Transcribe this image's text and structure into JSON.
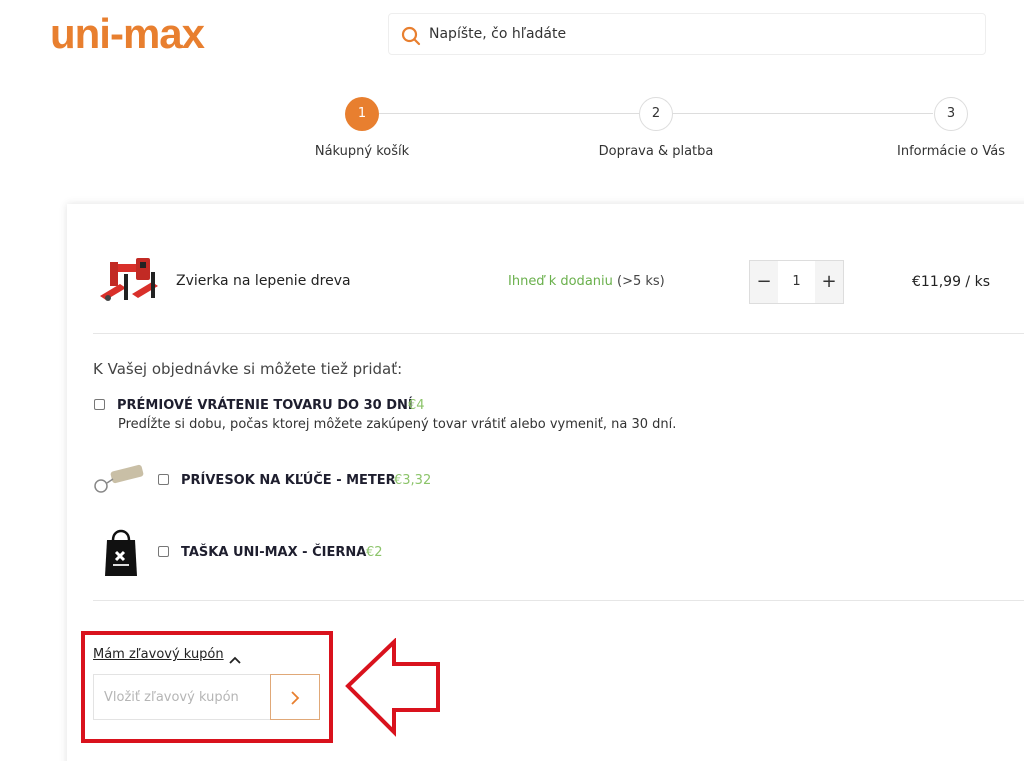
{
  "colors": {
    "brand": "#e87f2f",
    "available": "#6ab04c",
    "addon_price": "#8cc46a",
    "highlight": "#d9121d"
  },
  "header": {
    "logo_text": "uni-max",
    "search": {
      "placeholder": "Napíšte, čo hľadáte",
      "icon": "search-icon"
    }
  },
  "steps": [
    {
      "number": "1",
      "label": "Nákupný košík",
      "active": true
    },
    {
      "number": "2",
      "label": "Doprava & platba",
      "active": false
    },
    {
      "number": "3",
      "label": "Informácie o Vás",
      "active": false
    }
  ],
  "cart": {
    "item": {
      "name": "Zvierka na lepenie dreva",
      "availability": "Ihneď k dodaniu",
      "availability_qty": "(>5 ks)",
      "quantity": "1",
      "minus": "−",
      "plus": "+",
      "price": "€11,99 / ks",
      "image": "wood-clamp-image"
    }
  },
  "addons": {
    "title": "K Vašej objednávke si môžete tiež pridať:",
    "items": [
      {
        "name": "PRÉMIOVÉ VRÁTENIE TOVARU DO 30 DNÍ",
        "price": "€4",
        "description": "Predĺžte si dobu, počas ktorej môžete zakúpený tovar vrátiť alebo vymeniť, na 30 dní."
      },
      {
        "name": "PRÍVESOK NA KĽÚČE - METER",
        "price": "€3,32",
        "image": "keychain-meter-image"
      },
      {
        "name": "TAŠKA UNI-MAX - ČIERNA",
        "price": "€2",
        "image": "black-bag-image"
      }
    ]
  },
  "coupon": {
    "link_label": "Mám zľavový kupón",
    "input_placeholder": "Vložiť zľavový kupón",
    "submit_icon": "chevron-right-icon",
    "toggle_icon": "chevron-up-icon"
  }
}
